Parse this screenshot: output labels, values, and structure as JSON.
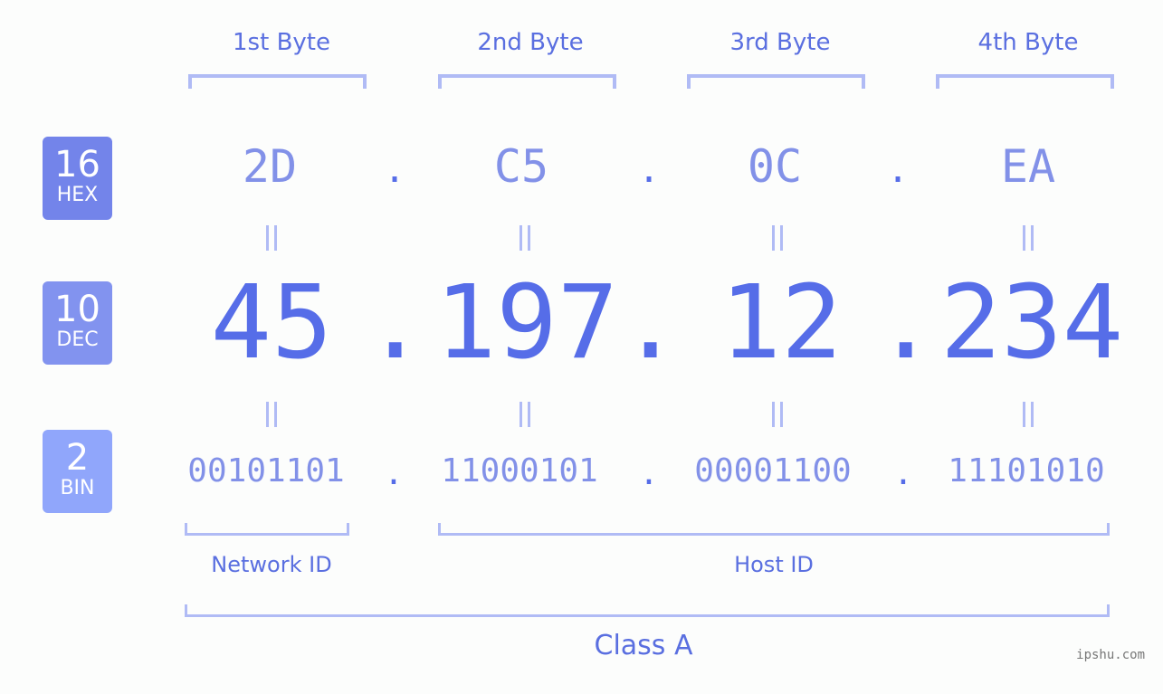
{
  "bytes": {
    "headers": [
      "1st Byte",
      "2nd Byte",
      "3rd Byte",
      "4th Byte"
    ]
  },
  "badges": {
    "hex": {
      "number": "16",
      "label": "HEX",
      "color": "#7384ea"
    },
    "dec": {
      "number": "10",
      "label": "DEC",
      "color": "#8293ef"
    },
    "bin": {
      "number": "2",
      "label": "BIN",
      "color": "#90a6fb"
    }
  },
  "ip": {
    "hex": [
      "2D",
      "C5",
      "0C",
      "EA"
    ],
    "dec": [
      "45",
      "197",
      "12",
      "234"
    ],
    "bin": [
      "00101101",
      "11000101",
      "00001100",
      "11101010"
    ],
    "separator": "."
  },
  "segments": {
    "network_id": "Network ID",
    "host_id": "Host ID",
    "class": "Class A"
  },
  "watermark": "ipshu.com",
  "colors": {
    "accent": "#566de8",
    "light": "#b0bbf5",
    "mid": "#8291e8"
  }
}
